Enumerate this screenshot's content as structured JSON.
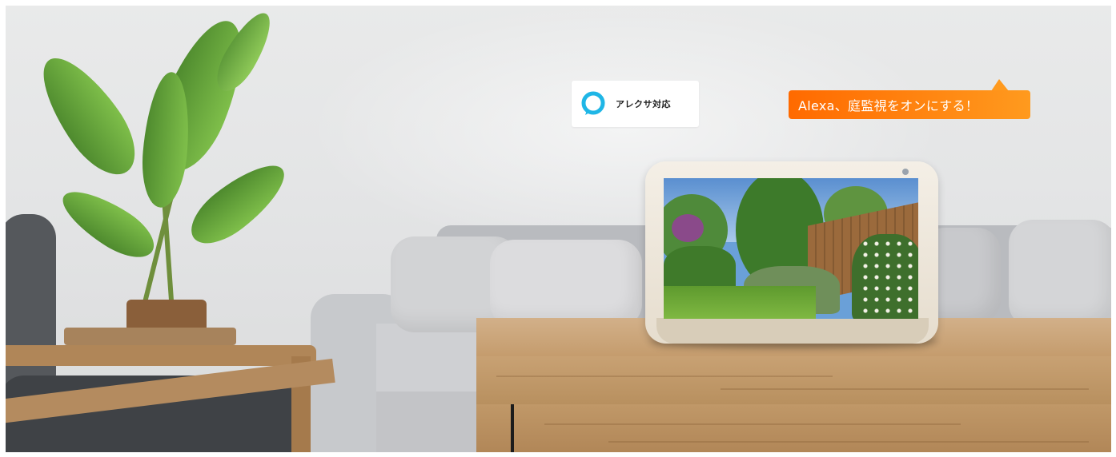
{
  "scene": {
    "description_free": true
  },
  "badge": {
    "label": "アレクサ対応",
    "icon": "alexa-ring-icon",
    "icon_color": "#1fb6e6"
  },
  "bubble": {
    "text": "Alexa、庭監視をオンにする！",
    "color_start": "#ff6a00",
    "color_end": "#ff9a1e"
  },
  "device": {
    "screen_content": "garden-camera-feed"
  }
}
